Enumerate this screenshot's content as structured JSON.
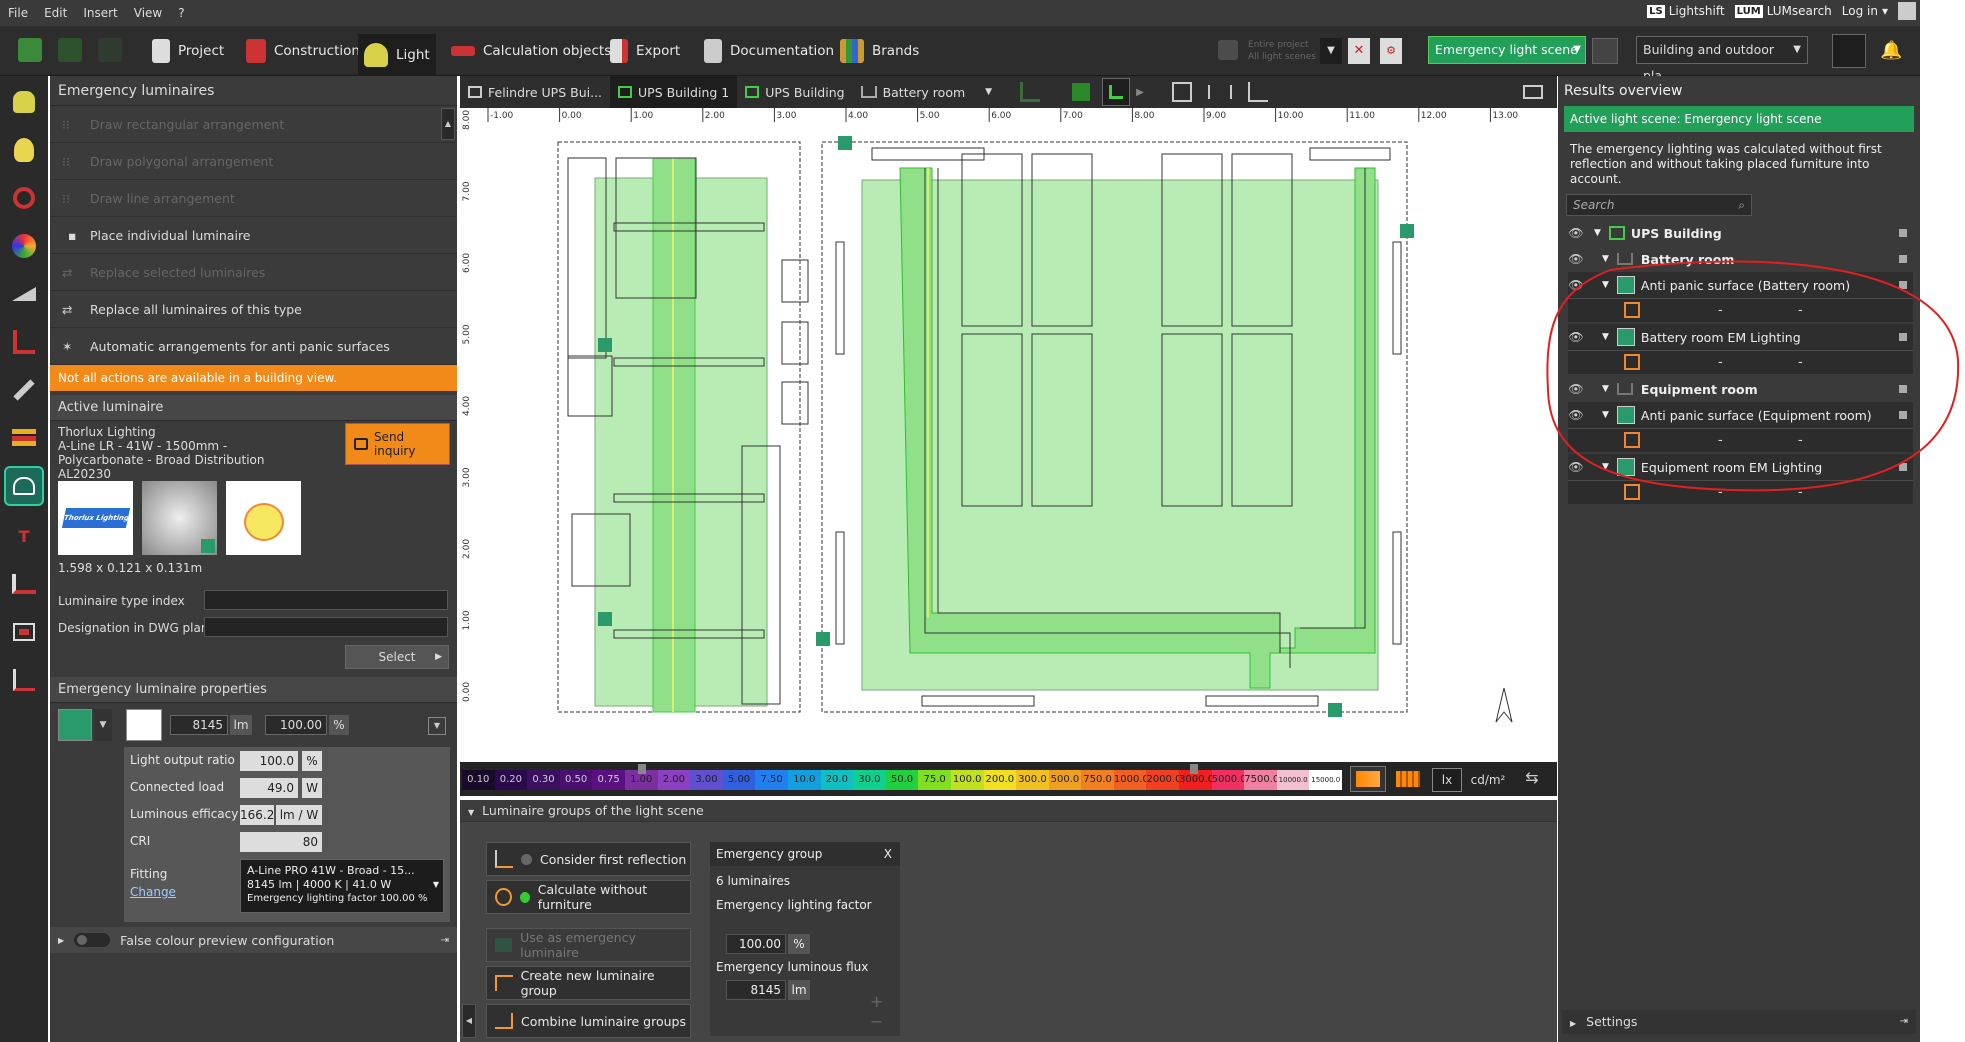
{
  "menu": [
    "File",
    "Edit",
    "Insert",
    "View",
    "?"
  ],
  "top_right": {
    "lightshift": "Lightshift",
    "lumsearch": "LUMsearch",
    "login": "Log in"
  },
  "toolbar": {
    "project": "Project",
    "construction": "Construction",
    "light": "Light",
    "calc": "Calculation objects",
    "export": "Export",
    "documentation": "Documentation",
    "brands": "Brands",
    "entire_project": "Entire project",
    "all_scenes": "All light scenes",
    "scene": "Emergency light scene",
    "view_select": "Building and outdoor pla..."
  },
  "left": {
    "title": "Emergency luminaires",
    "actions": [
      {
        "label": "Draw rectangular arrangement",
        "enabled": false
      },
      {
        "label": "Draw polygonal arrangement",
        "enabled": false
      },
      {
        "label": "Draw line arrangement",
        "enabled": false
      },
      {
        "label": "Place individual luminaire",
        "enabled": true
      },
      {
        "label": "Replace selected luminaires",
        "enabled": false
      },
      {
        "label": "Replace all luminaires of this type",
        "enabled": true
      },
      {
        "label": "Automatic arrangements for anti panic surfaces",
        "enabled": true
      }
    ],
    "warning": "Not all actions are available in a building view.",
    "active_title": "Active luminaire",
    "lum_brand": "Thorlux Lighting",
    "lum_name": "A-Line LR - 41W - 1500mm - Polycarbonate - Broad Distribution",
    "lum_code": "AL20230",
    "send_inquiry": "Send inquiry",
    "dims": "1.598 x 0.121 x 0.131m",
    "type_index_label": "Luminaire type index",
    "dwg_label": "Designation in DWG plan",
    "select_btn": "Select",
    "props_title": "Emergency luminaire properties",
    "flux": "8145",
    "flux_unit": "lm",
    "pct": "100.00",
    "pct_unit": "%",
    "props": [
      {
        "label": "Light output ratio",
        "value": "100.0",
        "unit": "%"
      },
      {
        "label": "Connected load",
        "value": "49.0",
        "unit": "W"
      },
      {
        "label": "Luminous efficacy",
        "value": "166.2",
        "unit": "lm / W"
      },
      {
        "label": "CRI",
        "value": "80",
        "unit": ""
      }
    ],
    "fitting_label": "Fitting",
    "change_label": "Change",
    "fitting_l1": "A-Line PRO 41W - Broad - 15...",
    "fitting_l2": "8145 lm  |  4000 K  |  41.0 W",
    "fitting_l3": "Emergency lighting factor  100.00 %",
    "false_colour": "False colour preview configuration",
    "logo_text": "Thorlux Lighting"
  },
  "view_tabs": [
    "Felindre UPS Bui...",
    "UPS Building 1",
    "UPS Building",
    "Battery room"
  ],
  "ruler_x": [
    "-1.00",
    "0.00",
    "1.00",
    "2.00",
    "3.00",
    "4.00",
    "5.00",
    "6.00",
    "7.00",
    "8.00",
    "9.00",
    "10.00",
    "11.00",
    "12.00",
    "13.00"
  ],
  "ruler_y": [
    "8.00",
    "7.00",
    "6.00",
    "5.00",
    "4.00",
    "3.00",
    "2.00",
    "1.00",
    "0.00"
  ],
  "scale": [
    "0.10",
    "0.20",
    "0.30",
    "0.50",
    "0.75",
    "1.00",
    "2.00",
    "3.00",
    "5.00",
    "7.50",
    "10.0",
    "20.0",
    "30.0",
    "50.0",
    "75.0",
    "100.0",
    "200.0",
    "300.0",
    "500.0",
    "750.0",
    "1000.0",
    "2000.0",
    "3000.0",
    "5000.0",
    "7500.0",
    "10000.0",
    "15000.0"
  ],
  "scale_colors": [
    "#1a0a2a",
    "#2a0a4a",
    "#3a1060",
    "#4a1070",
    "#5a1080",
    "#7a30a0",
    "#8a40c0",
    "#6050d0",
    "#3060e0",
    "#2080f0",
    "#10a0e0",
    "#10c0c0",
    "#10d090",
    "#20d040",
    "#80e020",
    "#c0e020",
    "#f0e020",
    "#f0c020",
    "#f0a020",
    "#f08020",
    "#f06020",
    "#f04020",
    "#f02020",
    "#f03060",
    "#f080a0",
    "#f0c0d0",
    "#ffffff"
  ],
  "scale_unit_lx": "lx",
  "scale_unit_cd": "cd/m²",
  "lower": {
    "title": "Luminaire groups of the light scene",
    "consider": "Consider first reflection",
    "calc_wo": "Calculate without furniture",
    "use_em": "Use as emergency luminaire",
    "create": "Create new luminaire group",
    "combine": "Combine luminaire groups",
    "group_title": "Emergency group",
    "close": "X",
    "count": "6 luminaires",
    "factor_label": "Emergency lighting factor",
    "factor": "100.00",
    "factor_unit": "%",
    "flux_label": "Emergency luminous flux",
    "flux": "8145",
    "flux_unit": "lm",
    "plus": "+",
    "minus": "−"
  },
  "right": {
    "title": "Results overview",
    "active_scene": "Active light scene: Emergency light scene",
    "note": "The emergency lighting was calculated without first reflection and without taking placed furniture into account.",
    "search_placeholder": "Search",
    "building": "UPS Building",
    "room1": "Battery room",
    "item1": "Anti panic surface (Battery room)",
    "item2": "Battery room EM Lighting",
    "room2": "Equipment room",
    "item3": "Anti panic surface (Equipment room)",
    "item4": "Equipment room EM Lighting",
    "dash": "-",
    "settings": "Settings"
  }
}
